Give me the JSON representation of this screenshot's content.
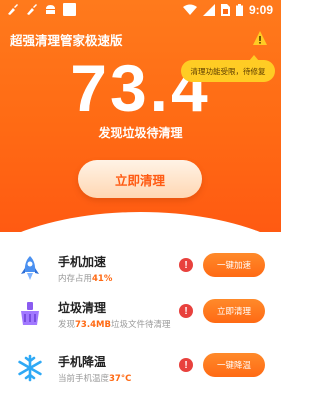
{
  "status_bar": {
    "time": "9:09",
    "icons": [
      "broom-icon",
      "broom-icon",
      "android-icon",
      "square-icon",
      "wifi-icon",
      "signal-icon",
      "sim-icon",
      "battery-icon"
    ]
  },
  "header": {
    "app_title": "超强清理管家极速版",
    "bell_icon": "warning-bell-icon"
  },
  "tooltip": {
    "text": "清理功能受限，待修复"
  },
  "score": {
    "value": "73.4",
    "subtitle": "发现垃圾待清理"
  },
  "clean_button": {
    "label": "立即清理"
  },
  "features": [
    {
      "title": "手机加速",
      "desc_prefix": "内存占用",
      "desc_value": "41%",
      "desc_suffix": "",
      "button": "一键加速",
      "icon": "rocket-icon"
    },
    {
      "title": "垃圾清理",
      "desc_prefix": "发现",
      "desc_value": "73.4MB",
      "desc_suffix": "垃圾文件待清理",
      "button": "立即清理",
      "icon": "trash-clean-icon"
    },
    {
      "title": "手机降温",
      "desc_prefix": "当前手机温度",
      "desc_value": "37°C",
      "desc_suffix": "",
      "button": "一键降温",
      "icon": "snowflake-icon"
    }
  ],
  "warning_glyph": "!",
  "colors": {
    "primary": "#ff6a14",
    "warning": "#e8413d",
    "tooltip": "#ffcc24"
  }
}
